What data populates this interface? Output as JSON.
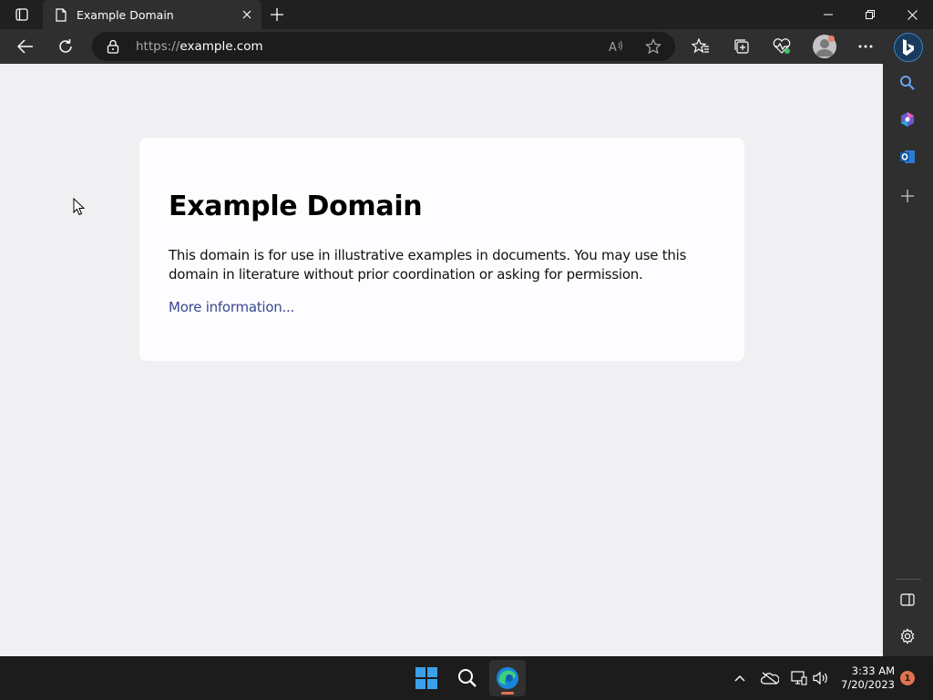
{
  "browser": {
    "tab": {
      "title": "Example Domain"
    },
    "address": {
      "protocol": "https://",
      "host": "example.com"
    },
    "icons": {
      "tab_actions": "tab-actions-icon",
      "favicon": "page-icon",
      "close_tab": "close-icon",
      "new_tab": "plus-icon",
      "minimize": "minimize-icon",
      "restore": "restore-icon",
      "close_window": "close-icon",
      "back": "back-arrow-icon",
      "refresh": "refresh-icon",
      "lock": "lock-icon",
      "read_aloud": "read-aloud-icon",
      "favorite": "star-icon",
      "favorites": "favorites-icon",
      "collections": "collections-icon",
      "performance": "heartbeat-icon",
      "profile": "profile-icon",
      "more": "more-icon",
      "copilot": "bing-icon"
    }
  },
  "page": {
    "heading": "Example Domain",
    "paragraph": "This domain is for use in illustrative examples in documents. You may use this domain in literature without prior coordination or asking for permission.",
    "link": "More information..."
  },
  "sidebar": {
    "items": [
      "search-icon",
      "copilot-icon",
      "outlook-icon",
      "plus-icon"
    ],
    "bottom": [
      "split-screen-icon",
      "gear-icon"
    ]
  },
  "taskbar": {
    "apps": [
      "windows-start-icon",
      "search-icon",
      "edge-icon"
    ],
    "tray": [
      "chevron-up-icon",
      "onedrive-icon",
      "network-icon",
      "volume-icon"
    ],
    "time": "3:33 AM",
    "date": "7/20/2023",
    "notification_count": "1"
  },
  "colors": {
    "page_bg": "#f0f0f2",
    "card_bg": "#fdfdff",
    "link": "#38488f",
    "chrome_dark": "#202020",
    "chrome": "#2f2f2f",
    "accent": "#e0734f"
  }
}
